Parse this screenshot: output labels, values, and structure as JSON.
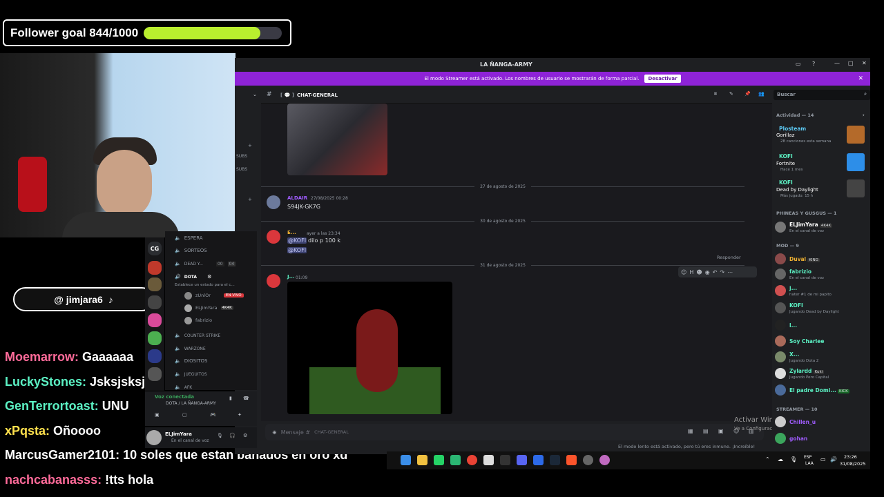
{
  "overlay": {
    "goal_label": "Follower goal 844/1000",
    "goal_progress": 0.844,
    "goal_color": "#b9ef2e",
    "tiktok_handle": "@ jimjara6"
  },
  "chat": [
    {
      "user": "Moemarrow:",
      "msg": " Gaaaaaa",
      "color": "#ff6b9a"
    },
    {
      "user": "LuckyStones:",
      "msg": " Jsksjsksj",
      "color": "#5cf2c4"
    },
    {
      "user": "GenTerrortoast:",
      "msg": " UNU",
      "color": "#5cf2c4"
    },
    {
      "user": "xPqsta:",
      "msg": " Oñoooo",
      "color": "#ffe14d"
    },
    {
      "user": "MarcusGamer2101:",
      "msg": " 10 soles que estan bañados en oro xd",
      "color": "#ffffff"
    },
    {
      "user": "nachcabanasss:",
      "msg": " !tts hola",
      "color": "#ff6b9a"
    }
  ],
  "discord": {
    "window_title": "LA ÑANGA-ARMY",
    "streamer_notice": "El modo Streamer está activado. Los nombres de usuario se mostrarán de forma parcial.",
    "streamer_button": "Desactivar",
    "channel_name": "CHAT-GENERAL",
    "search_placeholder": "Buscar",
    "date_sep_1": "27 de agosto de 2025",
    "date_sep_2": "30 de agosto de 2025",
    "date_sep_3": "31 de agosto de 2025",
    "msg1_author": "ALDAIR",
    "msg1_time": "27/08/2025 00:28",
    "msg1_text": "S94JK-GK7G",
    "msg2_author": "E...",
    "msg2_time": "ayer a las 23:34",
    "msg2_text": "dilo p 100 k",
    "msg2_mention": "@KOFI",
    "msg2_mention2": "@KOFI",
    "msg3_author": "J...",
    "msg3_time": "01:09",
    "reply_label": "Responder",
    "input_placeholder": "Mensaje #",
    "input_channel": "CHAT-GENERAL",
    "slowmode_note": "El modo lento está activado, pero tú eres inmune. ¡Increíble!",
    "activar_windows": "Activar Windows",
    "activar_windows_sub": "Ve a Configuración para activar Windows."
  },
  "channels": {
    "espera": "ESPERA",
    "sorteos": "SORTEOS",
    "dead": "DEAD Y...",
    "dead_count": "00",
    "dead_count2": "04",
    "dota": "DOTA",
    "dota_status": "Establece un estado para el c...",
    "u1": "zUnlOr",
    "u1_badge": "EN VIVO",
    "u2": "ELJimYara",
    "u2_badge": "4K4K",
    "u3": "fabrizio",
    "counter": "COUNTER STRIKE",
    "warzone": "WARZONE",
    "diositos": "DIOSITOS",
    "juegitos": "JUEGUITOS",
    "afk": "AFK",
    "voice_connected": "Voz conectada",
    "voice_channel": "DOTA / LA ÑANGA-ARMY",
    "user_name": "ELJimYara",
    "user_status": "En el canal de voz",
    "guild_cg": "CG",
    "subs1": "SUBS",
    "subs2": "SUBS"
  },
  "members": {
    "activity_header": "Actividad — 14",
    "act1_name": "Plosteam",
    "act1_game": "Gorillaz",
    "act1_sub": "28 canciones esta semana",
    "act2_name": "KOFI",
    "act2_game": "Fortnite",
    "act2_sub": "Hace 1 mes",
    "act3_name": "KOFI",
    "act3_game": "Dead by Daylight",
    "act3_sub": "Más jugado: 15 h",
    "group1": "PHINEAS Y GUSGUS — 1",
    "g1m1": "ELJimYara",
    "g1m1_tag": "4K4K",
    "g1m1_sub": "En el canal de voz",
    "group2": "MOD — 9",
    "mods": [
      {
        "name": "Duval",
        "tag": "KING",
        "sub": "",
        "color": "#f0b232"
      },
      {
        "name": "fabrizio",
        "tag": "",
        "sub": "En el canal de voz",
        "color": "#5cf2c4"
      },
      {
        "name": "j...",
        "tag": "",
        "sub": "hater #1 de mi papito",
        "color": "#5cf2c4"
      },
      {
        "name": "KOFI",
        "tag": "",
        "sub": "Jugando Dead by Daylight",
        "color": "#5cf2c4"
      },
      {
        "name": "l...",
        "tag": "",
        "sub": "",
        "color": "#5cf2c4"
      },
      {
        "name": "Soy Charlee",
        "tag": "",
        "sub": "",
        "color": "#5cf2c4"
      },
      {
        "name": "X...",
        "tag": "",
        "sub": "Jugando Dota 2",
        "color": "#5cf2c4"
      },
      {
        "name": "Zylardd",
        "tag": "Kuki",
        "sub": "Jugando Pero Capital",
        "color": "#5cf2c4"
      },
      {
        "name": "El padre Domi...",
        "tag": "KICK",
        "sub": "",
        "color": "#5cf2c4"
      }
    ],
    "group3": "STREAMER — 10",
    "s1": "Chillen_u",
    "s2": "gohan"
  },
  "taskbar": {
    "lang": "ESP",
    "lang2": "LAA",
    "time": "23:26",
    "date": "31/08/2025"
  }
}
